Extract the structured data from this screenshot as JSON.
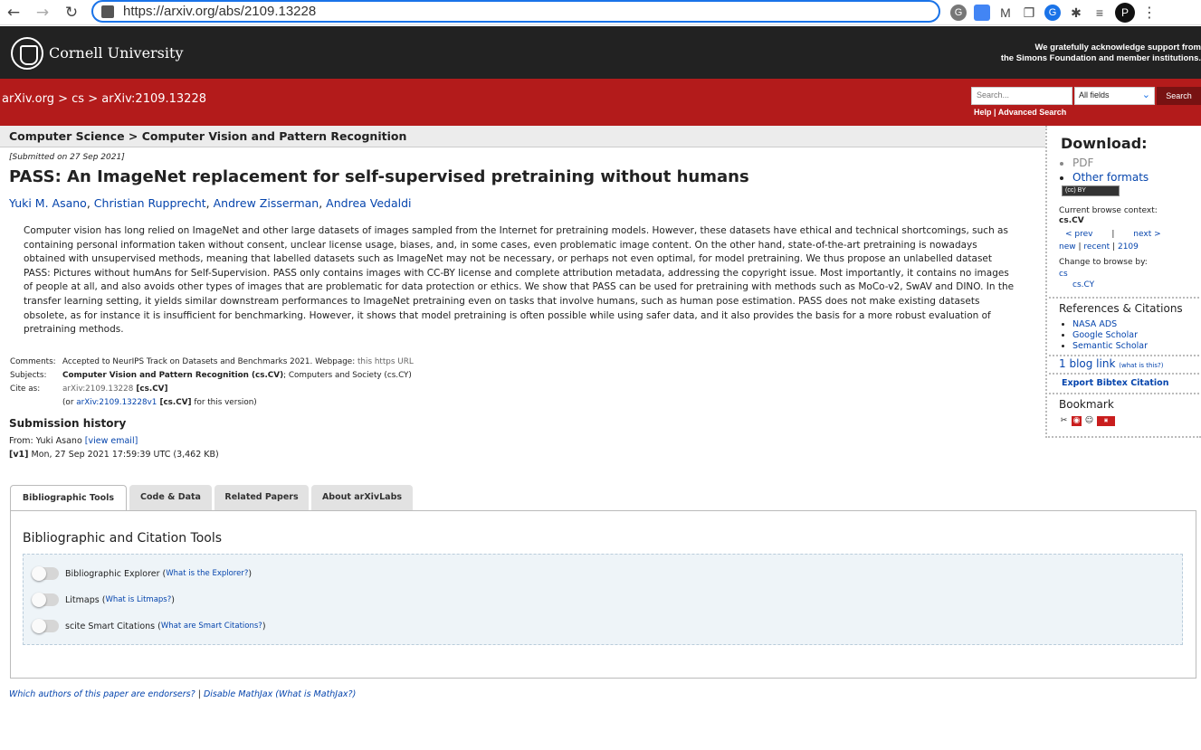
{
  "browser": {
    "url": "https://arxiv.org/abs/2109.13228",
    "back_glyph": "←",
    "forward_glyph": "→",
    "reload_glyph": "↻",
    "profile_initial": "P",
    "ext_g": "G",
    "ext_blue": "G"
  },
  "header": {
    "university": "Cornell University",
    "ack_line1": "We gratefully acknowledge support from",
    "ack_line2": "the Simons Foundation and member institutions."
  },
  "redbar": {
    "crumb_home": "arXiv.org",
    "crumb_sep": " > ",
    "crumb_cs": "cs",
    "crumb_id": "arXiv:2109.13228",
    "search_placeholder": "Search...",
    "search_field": "All fields",
    "search_button": "Search",
    "help": "Help",
    "link_sep": " | ",
    "advanced": "Advanced Search"
  },
  "main": {
    "subject_header": "Computer Science > Computer Vision and Pattern Recognition",
    "submitted": "[Submitted on 27 Sep 2021]",
    "title": "PASS: An ImageNet replacement for self-supervised pretraining without humans",
    "authors": [
      "Yuki M. Asano",
      "Christian Rupprecht",
      "Andrew Zisserman",
      "Andrea Vedaldi"
    ],
    "author_sep": ", ",
    "abstract": "Computer vision has long relied on ImageNet and other large datasets of images sampled from the Internet for pretraining models. However, these datasets have ethical and technical shortcomings, such as containing personal information taken without consent, unclear license usage, biases, and, in some cases, even problematic image content. On the other hand, state-of-the-art pretraining is nowadays obtained with unsupervised methods, meaning that labelled datasets such as ImageNet may not be necessary, or perhaps not even optimal, for model pretraining. We thus propose an unlabelled dataset PASS: Pictures without humAns for Self-Supervision. PASS only contains images with CC-BY license and complete attribution metadata, addressing the copyright issue. Most importantly, it contains no images of people at all, and also avoids other types of images that are problematic for data protection or ethics. We show that PASS can be used for pretraining with methods such as MoCo-v2, SwAV and DINO. In the transfer learning setting, it yields similar downstream performances to ImageNet pretraining even on tasks that involve humans, such as human pose estimation. PASS does not make existing datasets obsolete, as for instance it is insufficient for benchmarking. However, it shows that model pretraining is often possible while using safer data, and it also provides the basis for a more robust evaluation of pretraining methods.",
    "comments_key": "Comments:",
    "comments_val": "Accepted to NeurIPS Track on Datasets and Benchmarks 2021. Webpage: ",
    "comments_link": "this https URL",
    "subjects_key": "Subjects:",
    "subjects_bold": "Computer Vision and Pattern Recognition (cs.CV)",
    "subjects_rest": "; Computers and Society (cs.CY)",
    "cite_key": "Cite as:",
    "cite_id": "arXiv:2109.13228",
    "cite_tag": " [cs.CV]",
    "cite_or": "(or ",
    "cite_v1": "arXiv:2109.13228v1",
    "cite_v1_tag": " [cs.CV]",
    "cite_tail": " for this version)",
    "history_title": "Submission history",
    "from": "From: Yuki Asano ",
    "view_email": "[view email]",
    "v1_tag": "[v1]",
    "v1_text": " Mon, 27 Sep 2021 17:59:39 UTC (3,462 KB)"
  },
  "tabs": [
    {
      "label": "Bibliographic Tools"
    },
    {
      "label": "Code & Data"
    },
    {
      "label": "Related Papers"
    },
    {
      "label": "About arXivLabs"
    }
  ],
  "tools": {
    "title": "Bibliographic and Citation Tools",
    "items": [
      {
        "label": "Bibliographic Explorer",
        "help": "What is the Explorer?",
        "enabled": false
      },
      {
        "label": "Litmaps",
        "help": "What is Litmaps?",
        "enabled": false
      },
      {
        "label": "scite Smart Citations",
        "help": "What are Smart Citations?",
        "enabled": false
      }
    ]
  },
  "footer": {
    "endorsers": "Which authors of this paper are endorsers?",
    "sep": " | ",
    "mathjax": "Disable MathJax",
    "mathjax_help": "(What is MathJax?)"
  },
  "sidebar": {
    "download_title": "Download:",
    "pdf": "PDF",
    "other_formats": "Other formats",
    "license_badge": "(cc) BY",
    "context_label": "Current browse context:",
    "context_value": "cs.CV",
    "prev": "< prev",
    "pipe": "|",
    "next": "next >",
    "new": "new",
    "recent": "recent",
    "month": "2109",
    "change_label": "Change to browse by:",
    "browse_cs": "cs",
    "browse_cscy": "cs.CY",
    "refs_title": "References & Citations",
    "refs": [
      "NASA ADS",
      "Google Scholar",
      "Semantic Scholar"
    ],
    "blog": "1 blog link",
    "blog_help": "(what is this?)",
    "bibtex": "Export Bibtex Citation",
    "bookmark_title": "Bookmark"
  }
}
